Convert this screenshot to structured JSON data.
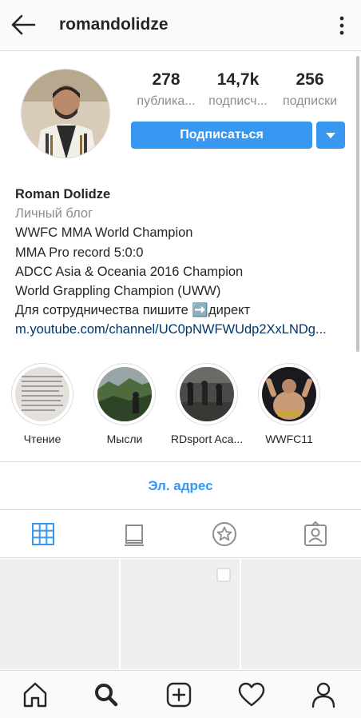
{
  "header": {
    "username": "romandolidze",
    "back_icon": "arrow-left-icon",
    "menu_icon": "more-vertical-icon"
  },
  "profile": {
    "stats": [
      {
        "value": "278",
        "label": "публика..."
      },
      {
        "value": "14,7k",
        "label": "подписч..."
      },
      {
        "value": "256",
        "label": "подписки"
      }
    ],
    "follow_label": "Подписаться",
    "dropdown_icon": "triangle-down-icon"
  },
  "bio": {
    "name": "Roman Dolidze",
    "category": "Личный блог",
    "lines": [
      "WWFC MMA  World Champion",
      "MMA Pro record 5:0:0",
      "ADCC Asia & Oceania 2016 Champion",
      "World Grappling Champion (UWW)",
      "Для сотрудничества пишите ➡️директ"
    ],
    "link": "m.youtube.com/channel/UC0pNWFWUdp2XxLNDg..."
  },
  "highlights": [
    {
      "label": "Чтение"
    },
    {
      "label": "Мысли"
    },
    {
      "label": "RDsport Aca..."
    },
    {
      "label": "WWFC11"
    }
  ],
  "contact": {
    "email_label": "Эл. адрес"
  },
  "tabs": [
    "grid-icon",
    "feed-icon",
    "star-icon",
    "tagged-icon"
  ],
  "bottom_nav": [
    "home-icon",
    "search-icon",
    "add-icon",
    "heart-icon",
    "profile-icon"
  ],
  "colors": {
    "accent": "#3897f0",
    "link": "#003569",
    "muted": "#8e8e8e",
    "border": "#dbdbdb"
  }
}
